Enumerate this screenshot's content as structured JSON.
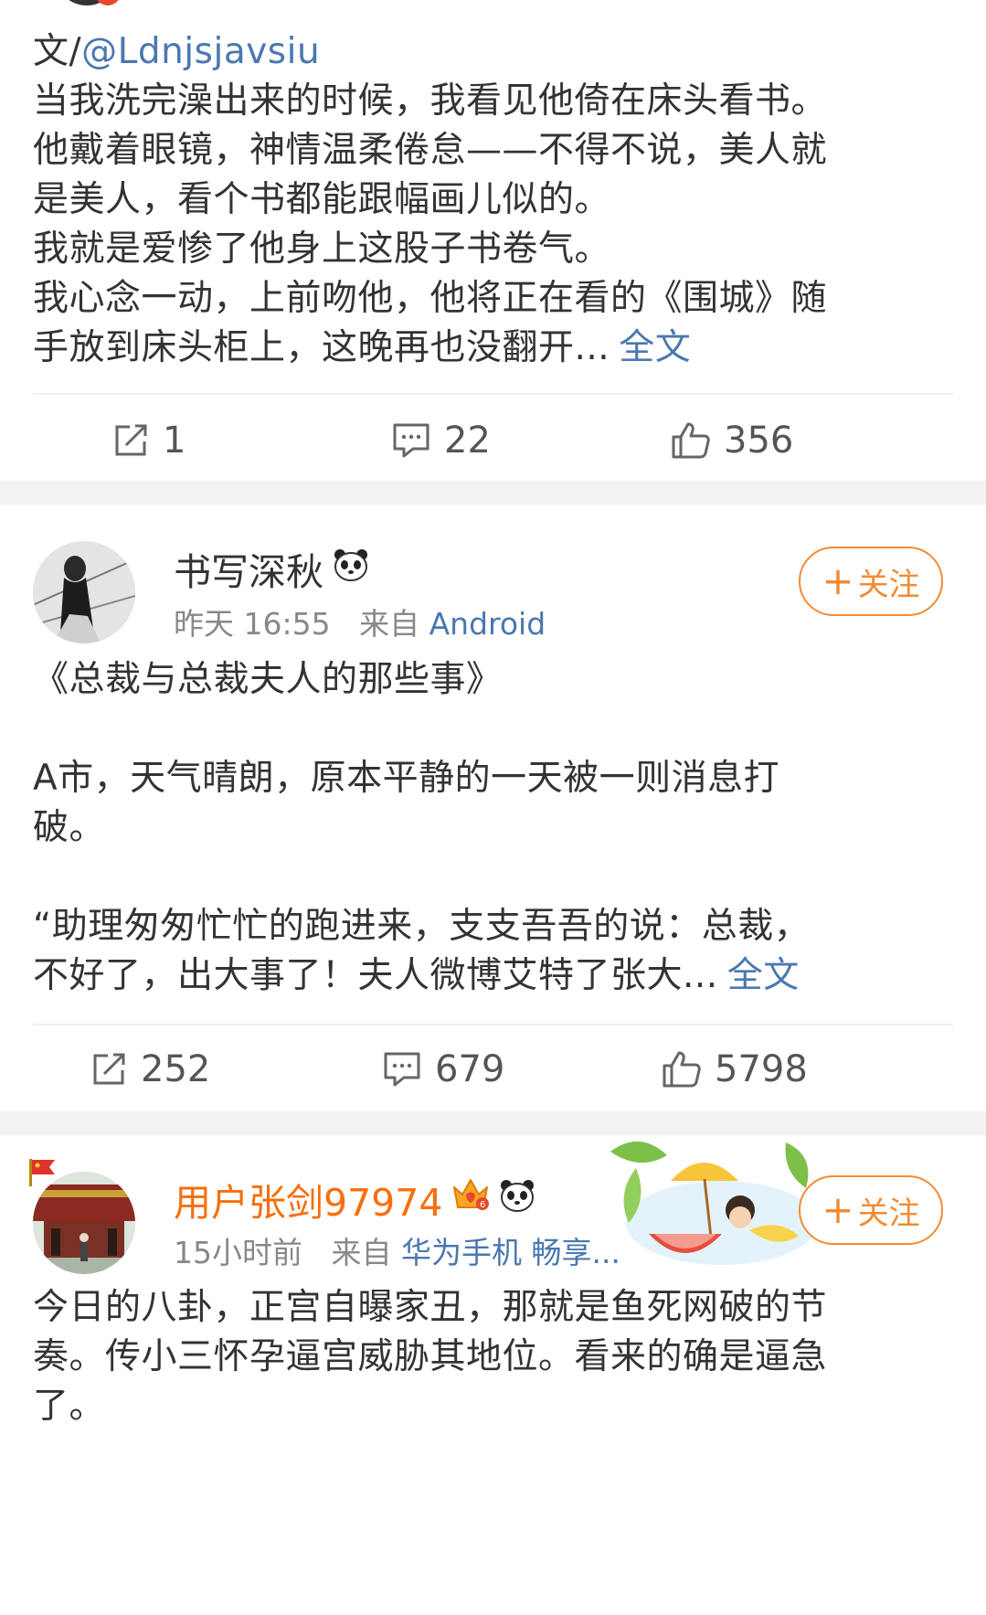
{
  "post1": {
    "author_prefix": "文/",
    "author_mention": "@Ldnjsjavsiu",
    "lines": [
      "当我洗完澡出来的时候，我看见他倚在床头看书。",
      "他戴着眼镜，神情温柔倦怠——不得不说，美人就",
      "是美人，看个书都能跟幅画儿似的。",
      "我就是爱惨了他身上这股子书卷气。",
      "我心念一动，上前吻他，他将正在看的《围城》随"
    ],
    "last_line": "手放到床头柜上，这晚再也没翻开...",
    "full_text_link": "全文",
    "repost_count": "1",
    "comment_count": "22",
    "like_count": "356"
  },
  "post2": {
    "username": "书写深秋",
    "time": "昨天 16:55",
    "from_label": "来自",
    "source": "Android",
    "follow_label": "关注",
    "lines": [
      "《总裁与总裁夫人的那些事》",
      "",
      "A市，天气晴朗，原本平静的一天被一则消息打",
      "破。",
      "",
      "“助理匆匆忙忙的跑进来，支支吾吾的说：总裁，"
    ],
    "last_line": "不好了，出大事了！夫人微博艾特了张大...",
    "full_text_link": "全文",
    "repost_count": "252",
    "comment_count": "679",
    "like_count": "5798"
  },
  "post3": {
    "username": "用户张剑97974",
    "time": "15小时前",
    "from_label": "来自",
    "source": "华为手机 畅享...",
    "follow_label": "关注",
    "lines": [
      "今日的八卦，正宫自曝家丑，那就是鱼死网破的节",
      "奏。传小三怀孕逼宫威胁其地位。看来的确是逼急",
      "了。"
    ]
  },
  "colors": {
    "link": "#4a78b0",
    "follow": "#f28b33",
    "vip_name": "#f86e0b",
    "separator": "#f2f2f2"
  },
  "icons": [
    "repost-icon",
    "comment-icon",
    "like-icon",
    "panda-icon",
    "crown-vip-icon",
    "plus-icon"
  ]
}
